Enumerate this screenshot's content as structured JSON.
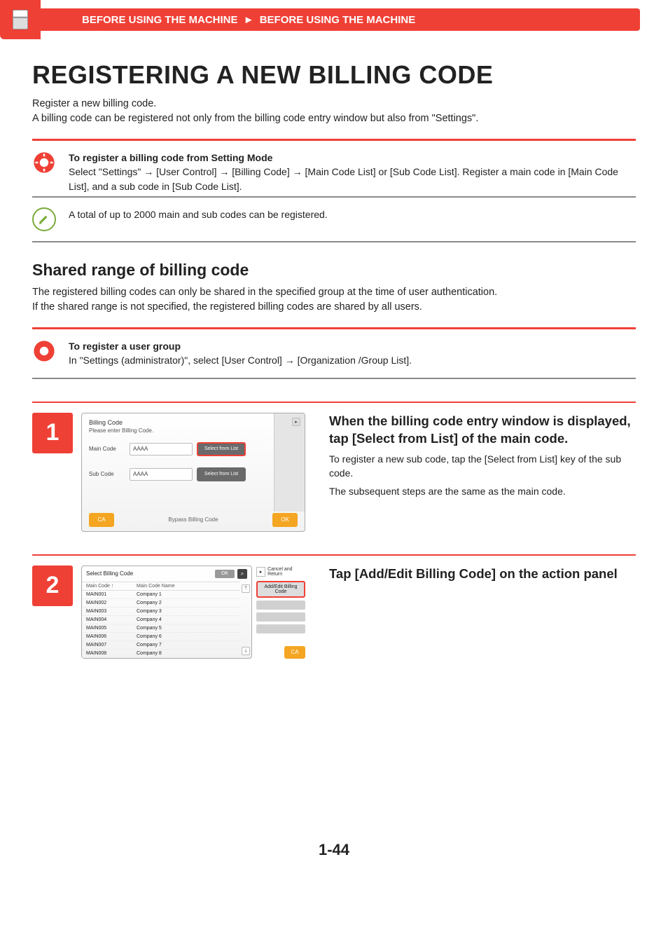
{
  "breadcrumb": {
    "left": "BEFORE USING THE MACHINE",
    "sep": "►",
    "right": "BEFORE USING THE MACHINE"
  },
  "title": "REGISTERING A NEW BILLING CODE",
  "intro1": "Register a new billing code.",
  "intro2": "A billing code can be registered not only from the billing code entry window but also from \"Settings\".",
  "note1": {
    "heading": "To register a billing code from Setting Mode",
    "body": "Select \"Settings\" → [User Control] → [Billing Code] → [Main Code List] or [Sub Code List]. Register a main code in [Main Code List], and a sub code in [Sub Code List]."
  },
  "note2": "A total of up to 2000 main and sub codes can be registered.",
  "section2": {
    "heading": "Shared range of billing code",
    "p1": "The registered billing codes can only be shared in the specified group at the time of user authentication.",
    "p2": "If the shared range is not specified, the registered billing codes are shared by all users."
  },
  "note3": {
    "heading": "To register a user group",
    "body": "In \"Settings (administrator)\", select [User Control] → [Organization /Group List]."
  },
  "steps": [
    {
      "num": "1",
      "heading": "When the billing code entry window is displayed, tap [Select from List] of the main code.",
      "p1": "To register a new sub code, tap the [Select from List] key of the sub code.",
      "p2": "The subsequent steps are the same as the main code.",
      "panel": {
        "title": "Billing Code",
        "sub": "Please enter Billing Code.",
        "main_label": "Main Code",
        "sub_label": "Sub Code",
        "value": "AAAA",
        "select_from_list": "Select from List",
        "ca": "CA",
        "bypass": "Bypass Billing Code",
        "ok": "OK"
      }
    },
    {
      "num": "2",
      "heading": "Tap [Add/Edit Billing Code] on the action panel",
      "panel": {
        "title": "Select Billing Code",
        "ok_head": "OK",
        "col1": "Main Code",
        "sort": "↑",
        "col2": "Main Code Name",
        "cancel": "Cancel and Return",
        "addedit": "Add/Edit Billing Code",
        "ca": "CA",
        "rows": [
          {
            "code": "MAIN001",
            "name": "Company 1"
          },
          {
            "code": "MAIN002",
            "name": "Company 2"
          },
          {
            "code": "MAIN003",
            "name": "Company 3"
          },
          {
            "code": "MAIN004",
            "name": "Company 4"
          },
          {
            "code": "MAIN005",
            "name": "Company 5"
          },
          {
            "code": "MAIN006",
            "name": "Company 6"
          },
          {
            "code": "MAIN007",
            "name": "Company 7"
          },
          {
            "code": "MAIN008",
            "name": "Company 8"
          }
        ]
      }
    }
  ],
  "page_number": "1-44"
}
